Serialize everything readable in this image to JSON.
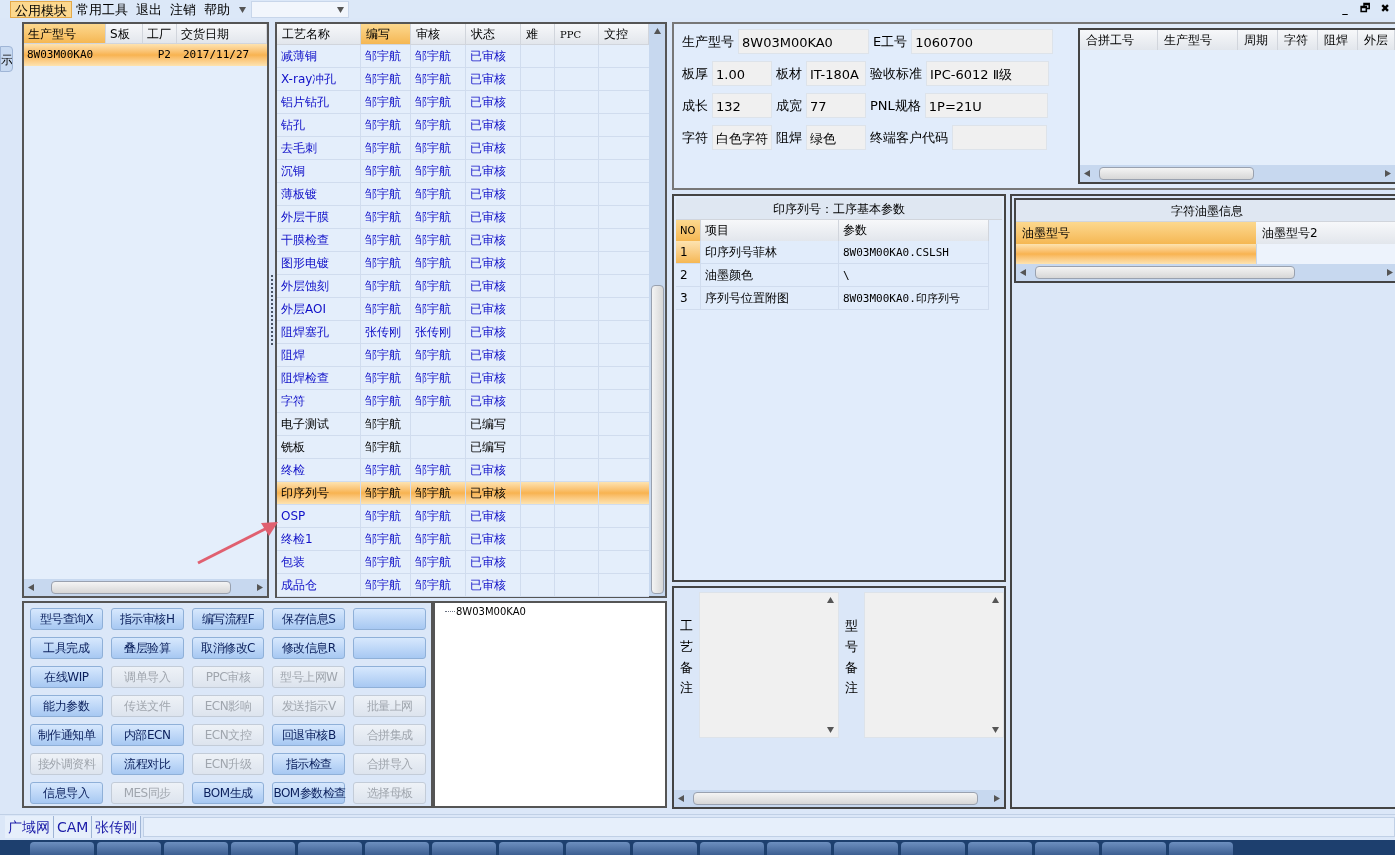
{
  "menu": [
    {
      "label": "公用模块",
      "selected": true
    },
    {
      "label": "常用工具",
      "selected": false
    },
    {
      "label": "退出",
      "selected": false
    },
    {
      "label": "注销",
      "selected": false
    },
    {
      "label": "帮助",
      "selected": false
    }
  ],
  "window_controls": [
    "_",
    "🗗",
    "✖"
  ],
  "side_tab": "示",
  "orders": {
    "columns": [
      {
        "label": "生产型号",
        "selected": true
      },
      {
        "label": "S板",
        "selected": false
      },
      {
        "label": "工厂",
        "selected": false
      },
      {
        "label": "交货日期",
        "selected": false
      }
    ],
    "rows": [
      {
        "cells": [
          "8W03M00KA0",
          "",
          "P2",
          "2017/11/27"
        ],
        "selected": true
      }
    ]
  },
  "process": {
    "columns": [
      {
        "label": "工艺名称",
        "selected": false
      },
      {
        "label": "编写",
        "selected": true
      },
      {
        "label": "审核",
        "selected": false
      },
      {
        "label": "状态",
        "selected": false
      },
      {
        "label": "难",
        "selected": false
      },
      {
        "label": "PPC",
        "selected": false
      },
      {
        "label": "文控",
        "selected": false
      }
    ],
    "rows": [
      {
        "cells": [
          "减薄铜",
          "邹宇航",
          "邹宇航",
          "已审核"
        ],
        "reviewed": true,
        "selected": false
      },
      {
        "cells": [
          "X-ray冲孔",
          "邹宇航",
          "邹宇航",
          "已审核"
        ],
        "reviewed": true,
        "selected": false
      },
      {
        "cells": [
          "铝片钻孔",
          "邹宇航",
          "邹宇航",
          "已审核"
        ],
        "reviewed": true,
        "selected": false
      },
      {
        "cells": [
          "钻孔",
          "邹宇航",
          "邹宇航",
          "已审核"
        ],
        "reviewed": true,
        "selected": false
      },
      {
        "cells": [
          "去毛刺",
          "邹宇航",
          "邹宇航",
          "已审核"
        ],
        "reviewed": true,
        "selected": false
      },
      {
        "cells": [
          "沉铜",
          "邹宇航",
          "邹宇航",
          "已审核"
        ],
        "reviewed": true,
        "selected": false
      },
      {
        "cells": [
          "薄板镀",
          "邹宇航",
          "邹宇航",
          "已审核"
        ],
        "reviewed": true,
        "selected": false
      },
      {
        "cells": [
          "外层干膜",
          "邹宇航",
          "邹宇航",
          "已审核"
        ],
        "reviewed": true,
        "selected": false
      },
      {
        "cells": [
          "干膜检查",
          "邹宇航",
          "邹宇航",
          "已审核"
        ],
        "reviewed": true,
        "selected": false
      },
      {
        "cells": [
          "图形电镀",
          "邹宇航",
          "邹宇航",
          "已审核"
        ],
        "reviewed": true,
        "selected": false
      },
      {
        "cells": [
          "外层蚀刻",
          "邹宇航",
          "邹宇航",
          "已审核"
        ],
        "reviewed": true,
        "selected": false
      },
      {
        "cells": [
          "外层AOI",
          "邹宇航",
          "邹宇航",
          "已审核"
        ],
        "reviewed": true,
        "selected": false
      },
      {
        "cells": [
          "阻焊塞孔",
          "张传刚",
          "张传刚",
          "已审核"
        ],
        "reviewed": true,
        "selected": false
      },
      {
        "cells": [
          "阻焊",
          "邹宇航",
          "邹宇航",
          "已审核"
        ],
        "reviewed": true,
        "selected": false
      },
      {
        "cells": [
          "阻焊检查",
          "邹宇航",
          "邹宇航",
          "已审核"
        ],
        "reviewed": true,
        "selected": false
      },
      {
        "cells": [
          "字符",
          "邹宇航",
          "邹宇航",
          "已审核"
        ],
        "reviewed": true,
        "selected": false
      },
      {
        "cells": [
          "电子测试",
          "邹宇航",
          "",
          "已编写"
        ],
        "reviewed": false,
        "selected": false
      },
      {
        "cells": [
          "铣板",
          "邹宇航",
          "",
          "已编写"
        ],
        "reviewed": false,
        "selected": false
      },
      {
        "cells": [
          "终检",
          "邹宇航",
          "邹宇航",
          "已审核"
        ],
        "reviewed": true,
        "selected": false
      },
      {
        "cells": [
          "印序列号",
          "邹宇航",
          "邹宇航",
          "已审核"
        ],
        "reviewed": true,
        "selected": true
      },
      {
        "cells": [
          "OSP",
          "邹宇航",
          "邹宇航",
          "已审核"
        ],
        "reviewed": true,
        "selected": false
      },
      {
        "cells": [
          "终检1",
          "邹宇航",
          "邹宇航",
          "已审核"
        ],
        "reviewed": true,
        "selected": false
      },
      {
        "cells": [
          "包装",
          "邹宇航",
          "邹宇航",
          "已审核"
        ],
        "reviewed": true,
        "selected": false
      },
      {
        "cells": [
          "成品仓",
          "邹宇航",
          "邹宇航",
          "已审核"
        ],
        "reviewed": true,
        "selected": false
      }
    ]
  },
  "buttons": [
    {
      "label": "型号查询X",
      "disabled": false
    },
    {
      "label": "指示审核H",
      "disabled": false
    },
    {
      "label": "编写流程F",
      "disabled": false
    },
    {
      "label": "保存信息S",
      "disabled": false
    },
    {
      "disabled": false
    },
    {
      "label": "工具完成",
      "disabled": false
    },
    {
      "label": "叠层验算",
      "disabled": false
    },
    {
      "label": "取消修改C",
      "disabled": false
    },
    {
      "label": "修改信息R",
      "disabled": false
    },
    {
      "disabled": false
    },
    {
      "label": "在线WIP",
      "disabled": false
    },
    {
      "label": "调单导入",
      "disabled": true
    },
    {
      "label": "PPC审核",
      "disabled": true
    },
    {
      "label": "型号上网W",
      "disabled": true
    },
    {
      "disabled": false
    },
    {
      "label": "能力参数",
      "disabled": false
    },
    {
      "label": "传送文件",
      "disabled": true
    },
    {
      "label": "ECN影响",
      "disabled": true
    },
    {
      "label": "发送指示V",
      "disabled": true
    },
    {
      "label": "批量上网",
      "disabled": true
    },
    {
      "label": "制作通知单",
      "disabled": false
    },
    {
      "label": "内部ECN",
      "disabled": false
    },
    {
      "label": "ECN文控",
      "disabled": true
    },
    {
      "label": "回退审核B",
      "disabled": false
    },
    {
      "label": "合拼集成",
      "disabled": true
    },
    {
      "label": "接外调资料",
      "disabled": true
    },
    {
      "label": "流程对比",
      "disabled": false
    },
    {
      "label": "ECN升级",
      "disabled": true
    },
    {
      "label": "指示检查",
      "disabled": false
    },
    {
      "label": "合拼导入",
      "disabled": true
    },
    {
      "label": "信息导入",
      "disabled": false
    },
    {
      "label": "MES同步",
      "disabled": true
    },
    {
      "label": "BOM生成",
      "disabled": false
    },
    {
      "label": "BOM参数检查",
      "disabled": false
    },
    {
      "label": "选择母板",
      "disabled": true
    }
  ],
  "tree": {
    "label": "8W03M00KA0"
  },
  "info_fields": [
    [
      {
        "label": "生产型号",
        "value": "8W03M00KA0"
      },
      {
        "label": "E工号",
        "value": "1060700"
      }
    ],
    [
      {
        "label": "板厚",
        "value": "1.00"
      },
      {
        "label": "板材",
        "value": "IT-180A"
      },
      {
        "label": "验收标准",
        "value": "IPC-6012 Ⅱ级"
      }
    ],
    [
      {
        "label": "成长",
        "value": "132"
      },
      {
        "label": "成宽",
        "value": "77"
      },
      {
        "label": "PNL规格",
        "value": "1P=21U"
      }
    ],
    [
      {
        "label": "字符",
        "value": "白色字符"
      },
      {
        "label": "阻焊",
        "value": "绿色"
      },
      {
        "label": "终端客户代码"
      }
    ]
  ],
  "merge_table": {
    "columns": [
      "合拼工号",
      "生产型号",
      "周期",
      "字符",
      "阻焊",
      "外层"
    ]
  },
  "params": {
    "title": "印序列号：工序基本参数",
    "columns": [
      {
        "label": "NO",
        "selected": true
      },
      {
        "label": "项目",
        "selected": false
      },
      {
        "label": "参数",
        "selected": false
      }
    ],
    "rows": [
      {
        "cells": [
          "1",
          "印序列号菲林",
          "8W03M00KA0.CSLSH"
        ],
        "selected": true
      },
      {
        "cells": [
          "2",
          "油墨颜色",
          "\\"
        ],
        "selected": false
      },
      {
        "cells": [
          "3",
          "序列号位置附图",
          "8W03M00KA0.印序列号"
        ],
        "selected": false
      }
    ]
  },
  "ink": {
    "title": "字符油墨信息",
    "columns": [
      {
        "label": "油墨型号",
        "selected": true
      },
      {
        "label": "油墨型号2",
        "selected": false
      }
    ]
  },
  "notes": [
    {
      "label": "工艺备注"
    },
    {
      "label": "型号备注"
    }
  ],
  "status_bar": [
    "广域网",
    "CAM",
    "张传刚"
  ]
}
